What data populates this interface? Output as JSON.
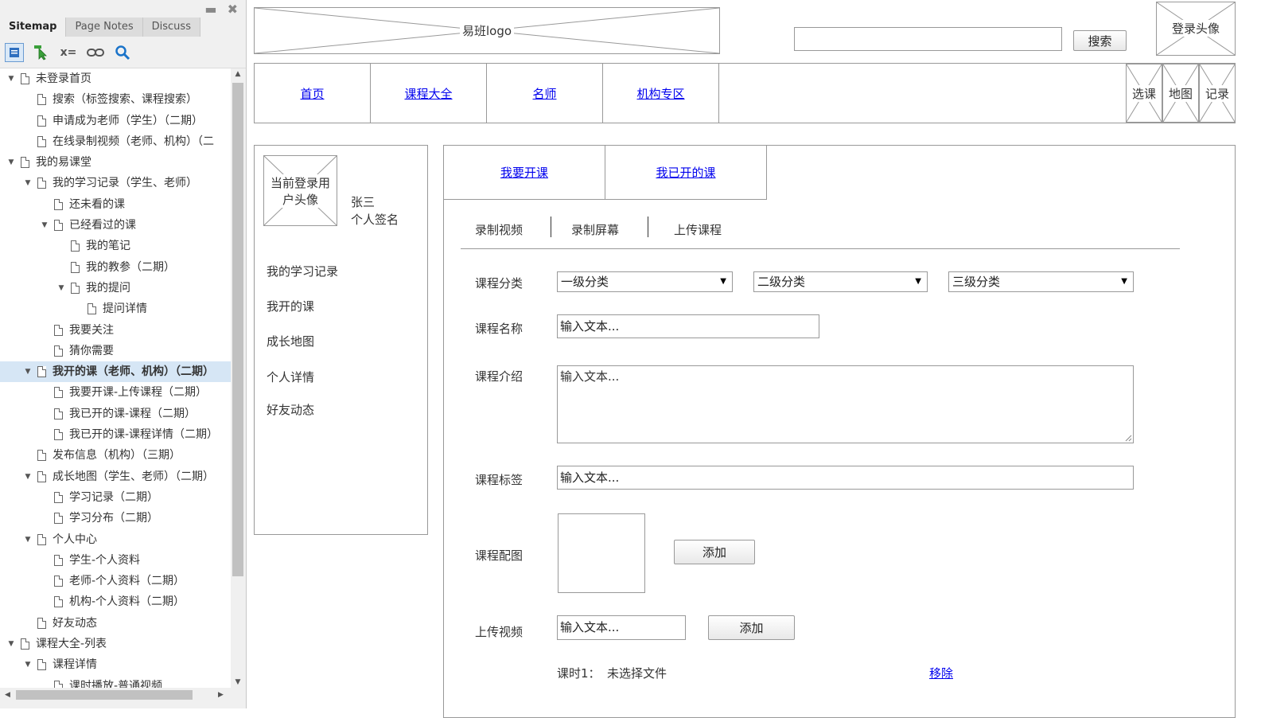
{
  "panel": {
    "tabs": [
      "Sitemap",
      "Page Notes",
      "Discuss"
    ],
    "controls": {
      "minimize": "▬",
      "close": "✖"
    },
    "tools": [
      "add-page-icon",
      "cursor-icon",
      "variable-icon",
      "link-icon",
      "search-icon"
    ],
    "tools_text": {
      "variable": "x="
    },
    "tree": [
      {
        "label": "未登录首页",
        "level": 0,
        "expanded": true
      },
      {
        "label": "搜索（标签搜索、课程搜索）",
        "level": 1
      },
      {
        "label": "申请成为老师（学生）（二期）",
        "level": 1
      },
      {
        "label": "在线录制视频（老师、机构）（二",
        "level": 1
      },
      {
        "label": "我的易课堂",
        "level": 0,
        "expanded": true
      },
      {
        "label": "我的学习记录（学生、老师）",
        "level": 1,
        "expanded": true
      },
      {
        "label": "还未看的课",
        "level": 2
      },
      {
        "label": "已经看过的课",
        "level": 2,
        "expanded": true
      },
      {
        "label": "我的笔记",
        "level": 3
      },
      {
        "label": "我的教参（二期）",
        "level": 3
      },
      {
        "label": "我的提问",
        "level": 3,
        "expanded": true
      },
      {
        "label": "提问详情",
        "level": 4
      },
      {
        "label": "我要关注",
        "level": 2
      },
      {
        "label": "猜你需要",
        "level": 2
      },
      {
        "label": "我开的课（老师、机构）（二期）",
        "level": 1,
        "expanded": true,
        "selected": true
      },
      {
        "label": "我要开课-上传课程（二期）",
        "level": 2
      },
      {
        "label": "我已开的课-课程（二期）",
        "level": 2
      },
      {
        "label": "我已开的课-课程详情（二期）",
        "level": 2
      },
      {
        "label": "发布信息（机构）（三期）",
        "level": 1
      },
      {
        "label": "成长地图（学生、老师）（二期）",
        "level": 1,
        "expanded": true
      },
      {
        "label": "学习记录（二期）",
        "level": 2
      },
      {
        "label": "学习分布（二期）",
        "level": 2
      },
      {
        "label": "个人中心",
        "level": 1,
        "expanded": true
      },
      {
        "label": "学生-个人资料",
        "level": 2
      },
      {
        "label": "老师-个人资料（二期）",
        "level": 2
      },
      {
        "label": "机构-个人资料（二期）",
        "level": 2
      },
      {
        "label": "好友动态",
        "level": 1
      },
      {
        "label": "课程大全-列表",
        "level": 0,
        "expanded": true
      },
      {
        "label": "课程详情",
        "level": 1,
        "expanded": true
      },
      {
        "label": "课时播放-普通视频",
        "level": 2
      }
    ]
  },
  "header": {
    "logo": "易班logo",
    "search_placeholder": "",
    "search_button": "搜索",
    "login_avatar": "登录头像"
  },
  "nav": {
    "links": [
      "首页",
      "课程大全",
      "名师",
      "机构专区"
    ],
    "right_icons": [
      "选课",
      "地图",
      "记录"
    ]
  },
  "profile": {
    "avatar": "当前登录用户头像",
    "name": "张三",
    "signature": "个人签名",
    "menu": [
      "我的学习记录",
      "我开的课",
      "成长地图",
      "个人详情",
      "好友动态"
    ]
  },
  "content": {
    "top_tabs": [
      "我要开课",
      "我已开的课"
    ],
    "sub_tabs": [
      "录制视频",
      "录制屏幕",
      "上传课程"
    ],
    "form": {
      "category_label": "课程分类",
      "category_options": [
        "一级分类",
        "二级分类",
        "三级分类"
      ],
      "name_label": "课程名称",
      "name_value": "输入文本...",
      "intro_label": "课程介绍",
      "intro_value": "输入文本...",
      "tags_label": "课程标签",
      "tags_value": "输入文本...",
      "image_label": "课程配图",
      "image_add": "添加",
      "video_label": "上传视频",
      "video_value": "输入文本...",
      "video_add": "添加",
      "lesson_label": "课时1：",
      "lesson_status": "未选择文件",
      "remove_link": "移除"
    }
  }
}
